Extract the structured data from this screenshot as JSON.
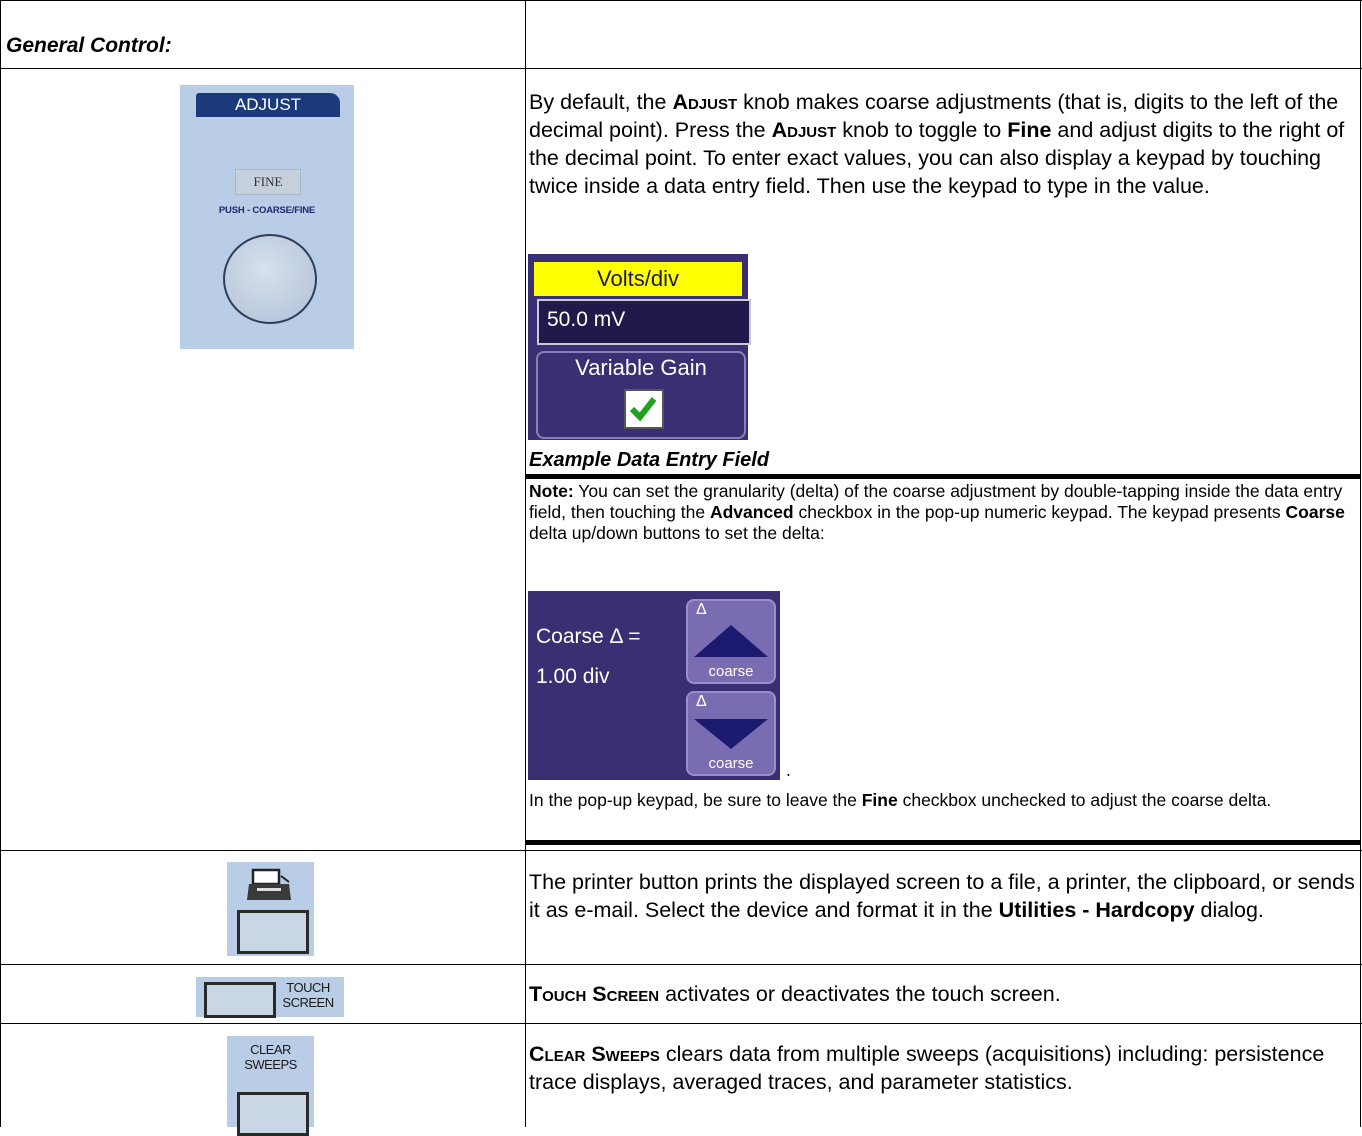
{
  "header": {
    "title": "General Control:"
  },
  "adjust_panel": {
    "banner": "ADJUST",
    "fine_label": "FINE",
    "push_label": "PUSH - COARSE/FINE"
  },
  "adjust_text": {
    "p1_a": "By default, the ",
    "p1_b": "Adjust",
    "p1_c": " knob makes coarse adjustments (that is, digits to the left of the decimal point). Press the ",
    "p1_d": "Adjust",
    "p1_e": " knob to toggle to ",
    "p1_f": "Fine",
    "p1_g": " and adjust digits to the right of the decimal point. To enter exact values, you can also display a keypad by touching twice inside a data entry field. Then use the keypad to type in the value."
  },
  "volts_widget": {
    "header": "Volts/div",
    "value": "50.0 mV",
    "checkbox_label": "Variable Gain",
    "checked": true
  },
  "caption": "Example Data Entry Field",
  "note": {
    "label": "Note:",
    "t1": " You can set the granularity (delta) of the coarse adjustment by double-tapping inside the data entry field, then touching the ",
    "t2": "Advanced",
    "t3": " checkbox in the pop-up numeric keypad. The keypad presents ",
    "t4": "Coarse",
    "t5": " delta up/down buttons to set the delta:",
    "after_image": ".",
    "f1": "In the pop-up keypad, be sure to leave the ",
    "f2": "Fine",
    "f3": " checkbox unchecked to adjust the coarse delta."
  },
  "coarse_widget": {
    "label_line1": "Coarse Δ =",
    "label_line2": "1.00 div",
    "delta_symbol": "Δ",
    "button_word": "coarse"
  },
  "printer_row": {
    "t1": "The printer button prints the displayed screen to a file, a printer, the clipboard, or sends it as e-mail. Select the device and format it in the ",
    "t2": "Utilities - Hardcopy",
    "t3": " dialog."
  },
  "touch_row": {
    "icon_label": "TOUCH SCREEN",
    "t1": "Touch Screen",
    "t2": " activates or deactivates the touch screen."
  },
  "clear_row": {
    "icon_label": "CLEAR SWEEPS",
    "t1": "Clear Sweeps",
    "t2": " clears data from multiple sweeps (acquisitions) including: persistence trace displays, averaged traces, and parameter statistics."
  }
}
